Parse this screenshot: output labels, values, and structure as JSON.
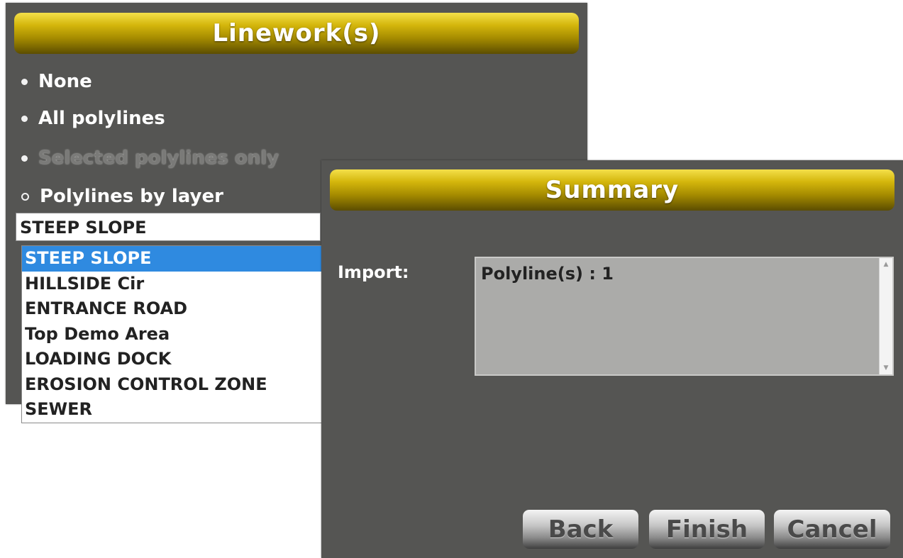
{
  "linework": {
    "title": "Linework(s)",
    "options": [
      {
        "label": "None",
        "state": "normal"
      },
      {
        "label": "All polylines",
        "state": "normal"
      },
      {
        "label": "Selected polylines only",
        "state": "disabled"
      },
      {
        "label": "Polylines by layer",
        "state": "selected"
      }
    ],
    "layer_value": "STEEP SLOPE",
    "layer_options": [
      "STEEP SLOPE",
      "HILLSIDE Cir",
      "ENTRANCE ROAD",
      "Top Demo Area",
      "LOADING DOCK",
      "EROSION CONTROL ZONE",
      "SEWER"
    ],
    "highlighted_option": "STEEP SLOPE"
  },
  "summary": {
    "title": "Summary",
    "import_label": "Import:",
    "import_text": "Polyline(s) : 1",
    "buttons": {
      "back": "Back",
      "finish": "Finish",
      "cancel": "Cancel"
    }
  },
  "colors": {
    "panel_bg": "#555553",
    "title_gold": "#d4b60c",
    "list_highlight": "#2f8ae0"
  }
}
